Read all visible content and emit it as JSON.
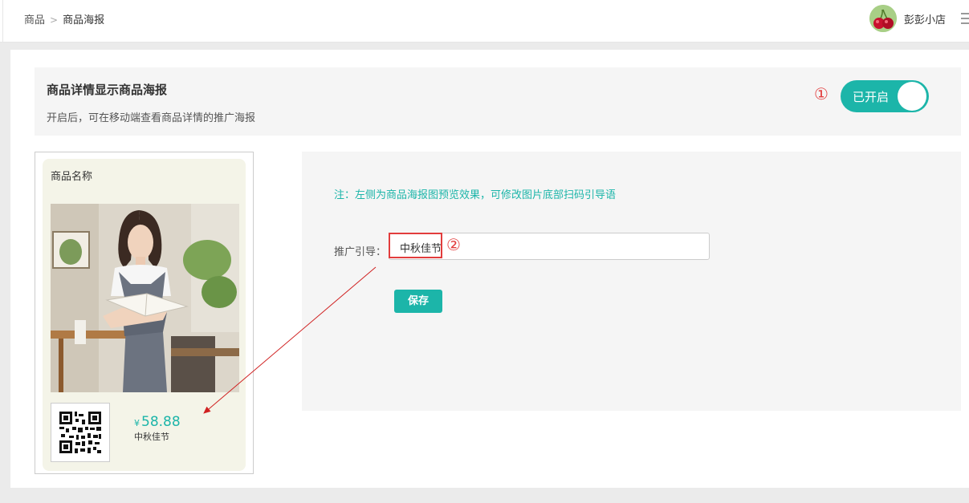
{
  "breadcrumb": {
    "parent": "商品",
    "separator": ">",
    "current": "商品海报"
  },
  "header": {
    "shop_name": "彭彭小店"
  },
  "setting": {
    "title": "商品详情显示商品海报",
    "description": "开启后，可在移动端查看商品详情的推广海报",
    "toggle_label": "已开启",
    "toggle_on": true,
    "annotation": "①"
  },
  "poster": {
    "name_label": "商品名称",
    "currency": "¥",
    "price": "58.88",
    "slogan": "中秋佳节"
  },
  "form": {
    "note": "注：左侧为商品海报图预览效果，可修改图片底部扫码引导语",
    "field_label": "推广引导：",
    "field_value": "中秋佳节",
    "annotation": "②",
    "save_label": "保存"
  },
  "colors": {
    "accent": "#1cb5a9",
    "annotation_red": "#e23d3d",
    "panel_bg": "#f5f5f5",
    "poster_bg": "#f4f4e8"
  },
  "icons": {
    "menu": "menu-icon",
    "avatar": "cherry-avatar",
    "qr": "qr-code-icon"
  }
}
